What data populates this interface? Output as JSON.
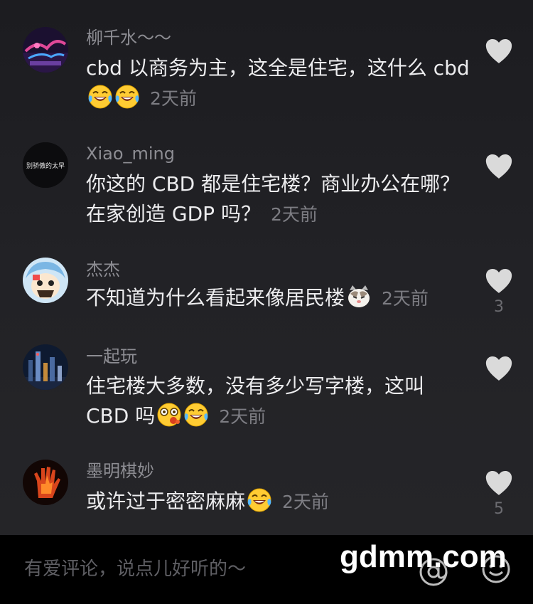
{
  "comments": [
    {
      "username": "柳千水～～",
      "text": "cbd 以商务为主，这全是住宅，这什么 cbd",
      "emojis": [
        "face-with-tears-of-joy",
        "face-with-tears-of-joy"
      ],
      "time": "2天前",
      "likes": ""
    },
    {
      "username": "Xiao_ming",
      "avatar_text": "别骄傲的太早",
      "text": "你这的 CBD 都是住宅楼？商业办公在哪？在家创造 GDP 吗？",
      "emojis": [],
      "time": "2天前",
      "likes": ""
    },
    {
      "username": "杰杰",
      "text": "不知道为什么看起来像居民楼",
      "emojis": [
        "cat-face"
      ],
      "time": "2天前",
      "likes": "3"
    },
    {
      "username": "一起玩",
      "text": "住宅楼大多数，没有多少写字楼，这叫 CBD 吗",
      "emojis": [
        "dizzy-spitting-face",
        "face-with-tears-of-joy"
      ],
      "time": "2天前",
      "likes": ""
    },
    {
      "username": "墨明棋妙",
      "text": "或许过于密密麻麻",
      "emojis": [
        "face-with-tears-of-joy"
      ],
      "time": "2天前",
      "likes": "5"
    }
  ],
  "input": {
    "placeholder": "有爱评论，说点儿好听的～"
  },
  "icons": {
    "like": "heart-icon",
    "mention": "at-sign-icon",
    "emoji": "smile-icon"
  },
  "watermark": "gdmm.com",
  "colors": {
    "background": "#1f1f23",
    "username": "#8d8d93",
    "comment_text": "#ececee",
    "time": "#7d7d83",
    "heart": "#dadada",
    "input_bar": "#000000"
  }
}
